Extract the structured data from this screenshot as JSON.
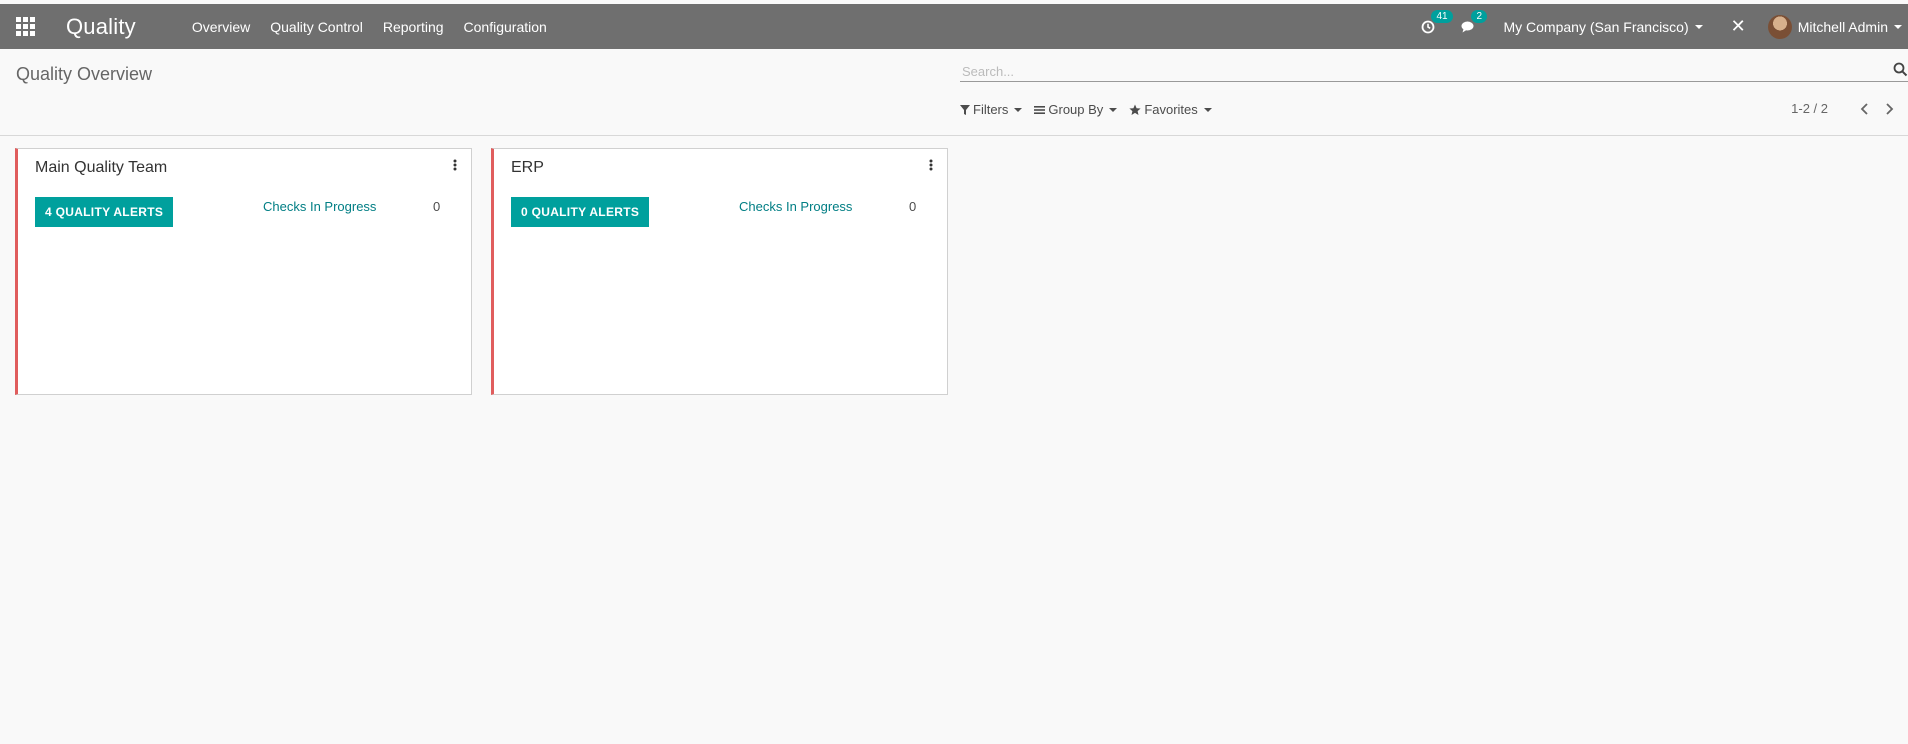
{
  "navbar": {
    "app_name": "Quality",
    "menu": [
      "Overview",
      "Quality Control",
      "Reporting",
      "Configuration"
    ],
    "activity_count": "41",
    "message_count": "2",
    "company": "My Company (San Francisco)",
    "user": "Mitchell Admin"
  },
  "control_panel": {
    "title": "Quality Overview",
    "search_placeholder": "Search...",
    "filters_label": "Filters",
    "groupby_label": "Group By",
    "favorites_label": "Favorites",
    "pager": "1-2 / 2"
  },
  "teams": [
    {
      "name": "Main Quality Team",
      "alerts_label": "4 QUALITY ALERTS",
      "checks_label": "Checks In Progress",
      "checks_count": "0"
    },
    {
      "name": "ERP",
      "alerts_label": "0 QUALITY ALERTS",
      "checks_label": "Checks In Progress",
      "checks_count": "0"
    }
  ],
  "colors": {
    "navbar": "#6f6f6f",
    "accent": "#00a09d",
    "link": "#017e84",
    "card_border": "#e05d5d"
  }
}
